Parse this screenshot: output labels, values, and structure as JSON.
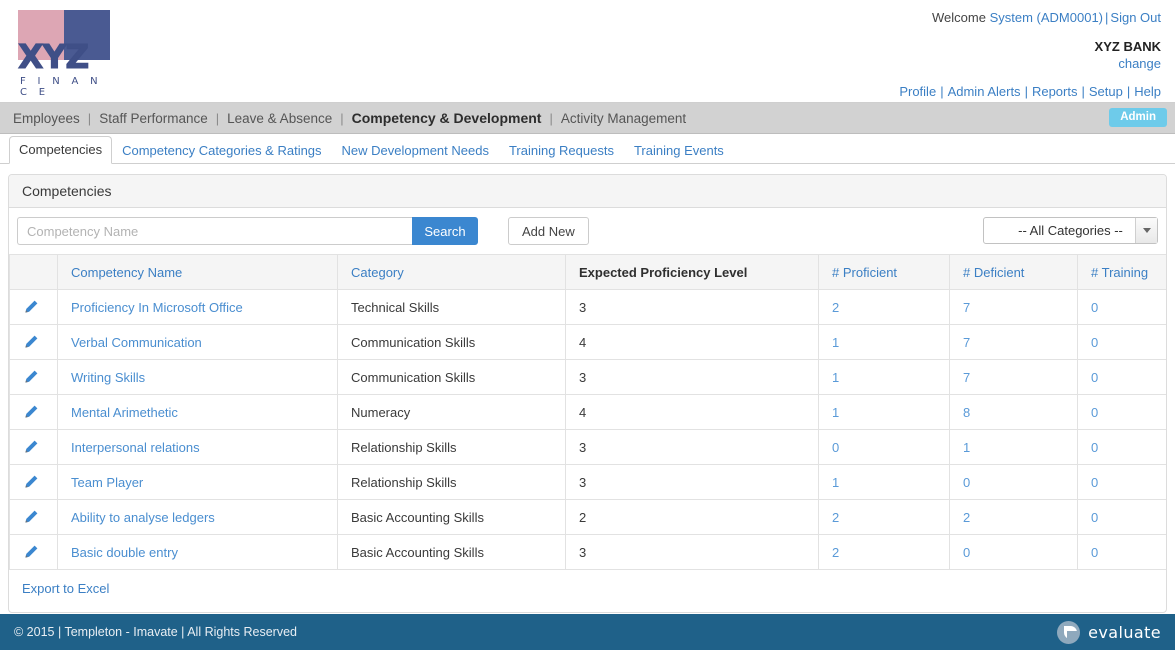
{
  "brand": {
    "logo_text": "XYZ",
    "logo_subtext": "F I N A N C E",
    "pink": "#dda6b4",
    "blue": "#4a5a92"
  },
  "header": {
    "welcome_label": "Welcome",
    "user": "System (ADM0001)",
    "sign_out": "Sign Out",
    "org": "XYZ BANK",
    "change": "change",
    "links": [
      "Profile",
      "Admin Alerts",
      "Reports",
      "Setup",
      "Help"
    ],
    "separator": "|"
  },
  "mainnav": {
    "items": [
      {
        "label": "Employees",
        "active": false
      },
      {
        "label": "Staff Performance",
        "active": false
      },
      {
        "label": "Leave & Absence",
        "active": false
      },
      {
        "label": "Competency & Development",
        "active": true
      },
      {
        "label": "Activity Management",
        "active": false
      }
    ],
    "separator": "|",
    "badge": "Admin",
    "badge_color": "#6ecbea"
  },
  "tabs": [
    {
      "label": "Competencies",
      "active": true
    },
    {
      "label": "Competency Categories & Ratings",
      "active": false
    },
    {
      "label": "New Development Needs",
      "active": false
    },
    {
      "label": "Training Requests",
      "active": false
    },
    {
      "label": "Training Events",
      "active": false
    }
  ],
  "panel": {
    "title": "Competencies"
  },
  "toolbar": {
    "search_placeholder": "Competency Name",
    "search_value": "",
    "search_label": "Search",
    "add_new_label": "Add New",
    "category_selected": "-- All Categories --"
  },
  "table": {
    "headers": [
      {
        "label": "",
        "link": false
      },
      {
        "label": "Competency Name",
        "link": true
      },
      {
        "label": "Category",
        "link": true
      },
      {
        "label": "Expected Proficiency Level",
        "link": false
      },
      {
        "label": "# Proficient",
        "link": true
      },
      {
        "label": "# Deficient",
        "link": true
      },
      {
        "label": "# Training",
        "link": true
      }
    ],
    "rows": [
      {
        "name": "Proficiency In Microsoft Office",
        "category": "Technical Skills",
        "expected": "3",
        "proficient": "2",
        "deficient": "7",
        "training": "0"
      },
      {
        "name": "Verbal Communication",
        "category": "Communication Skills",
        "expected": "4",
        "proficient": "1",
        "deficient": "7",
        "training": "0"
      },
      {
        "name": "Writing Skills",
        "category": "Communication Skills",
        "expected": "3",
        "proficient": "1",
        "deficient": "7",
        "training": "0"
      },
      {
        "name": "Mental Arimethetic",
        "category": "Numeracy",
        "expected": "4",
        "proficient": "1",
        "deficient": "8",
        "training": "0"
      },
      {
        "name": "Interpersonal relations",
        "category": "Relationship Skills",
        "expected": "3",
        "proficient": "0",
        "deficient": "1",
        "training": "0"
      },
      {
        "name": "Team Player",
        "category": "Relationship Skills",
        "expected": "3",
        "proficient": "1",
        "deficient": "0",
        "training": "0"
      },
      {
        "name": "Ability to analyse ledgers",
        "category": "Basic Accounting Skills",
        "expected": "2",
        "proficient": "2",
        "deficient": "2",
        "training": "0"
      },
      {
        "name": "Basic double entry",
        "category": "Basic Accounting Skills",
        "expected": "3",
        "proficient": "2",
        "deficient": "0",
        "training": "0"
      }
    ],
    "export_label": "Export to Excel"
  },
  "footer": {
    "copyright": "© 2015 | Templeton - Imavate | All Rights Reserved",
    "product": "evaluate",
    "bg": "#1f6189"
  }
}
